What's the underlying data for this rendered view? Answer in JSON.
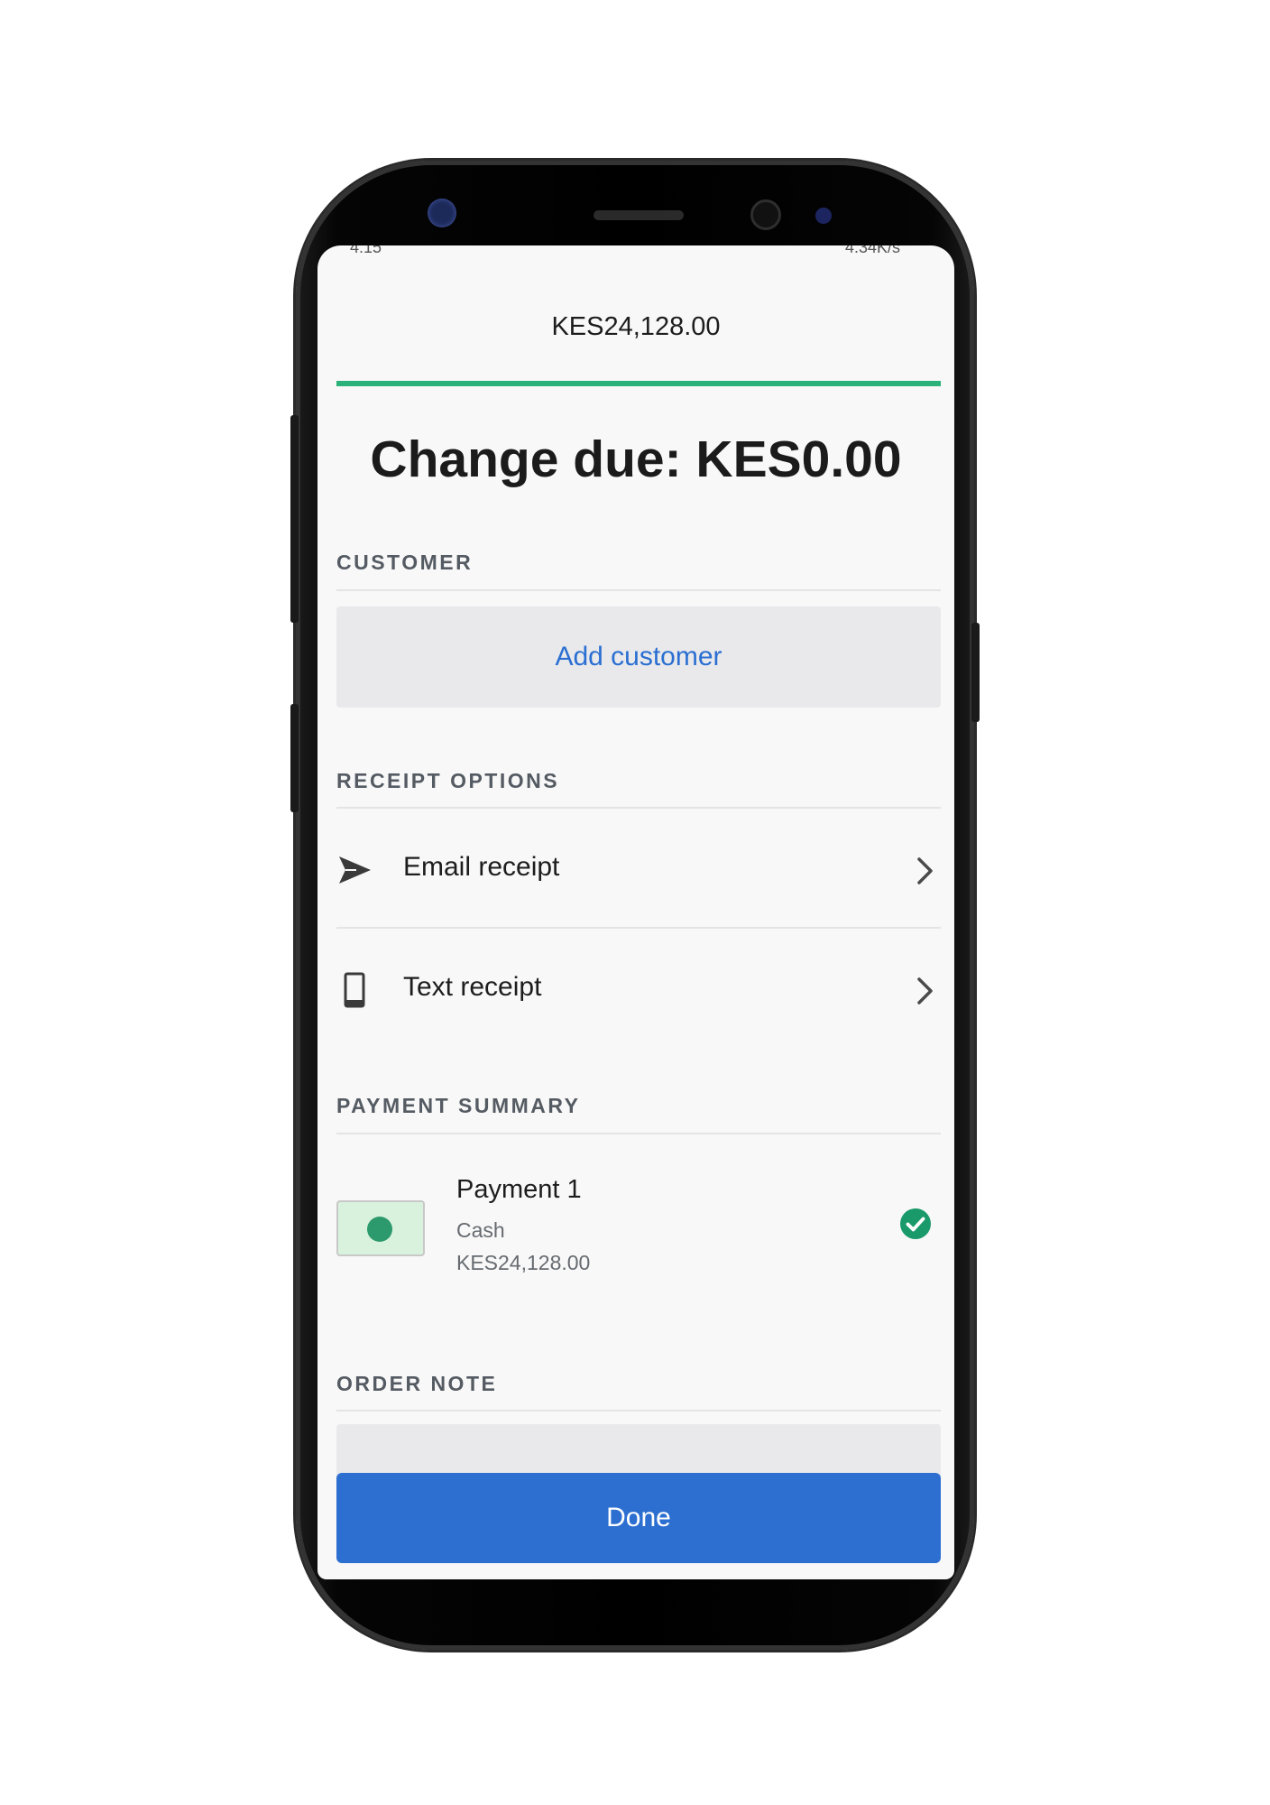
{
  "status_bar": {
    "left_text": "4:15",
    "right_text": "4.34K/s"
  },
  "header": {
    "amount": "KES24,128.00"
  },
  "change_due": "Change due: KES0.00",
  "customer": {
    "section_label": "CUSTOMER",
    "add_button_label": "Add customer"
  },
  "receipt_options": {
    "section_label": "RECEIPT OPTIONS",
    "items": [
      {
        "label": "Email receipt",
        "icon": "send-icon"
      },
      {
        "label": "Text receipt",
        "icon": "phone-icon"
      }
    ]
  },
  "payment_summary": {
    "section_label": "PAYMENT SUMMARY",
    "payments": [
      {
        "title": "Payment 1",
        "method": "Cash",
        "amount": "KES24,128.00",
        "status_icon": "check-circle-icon"
      }
    ]
  },
  "order_note": {
    "section_label": "ORDER NOTE"
  },
  "done_button_label": "Done",
  "colors": {
    "accent_green": "#2bb27a",
    "primary_blue": "#2d6fd1",
    "link_blue": "#2a6fd1",
    "success_green": "#1a9a6a"
  }
}
